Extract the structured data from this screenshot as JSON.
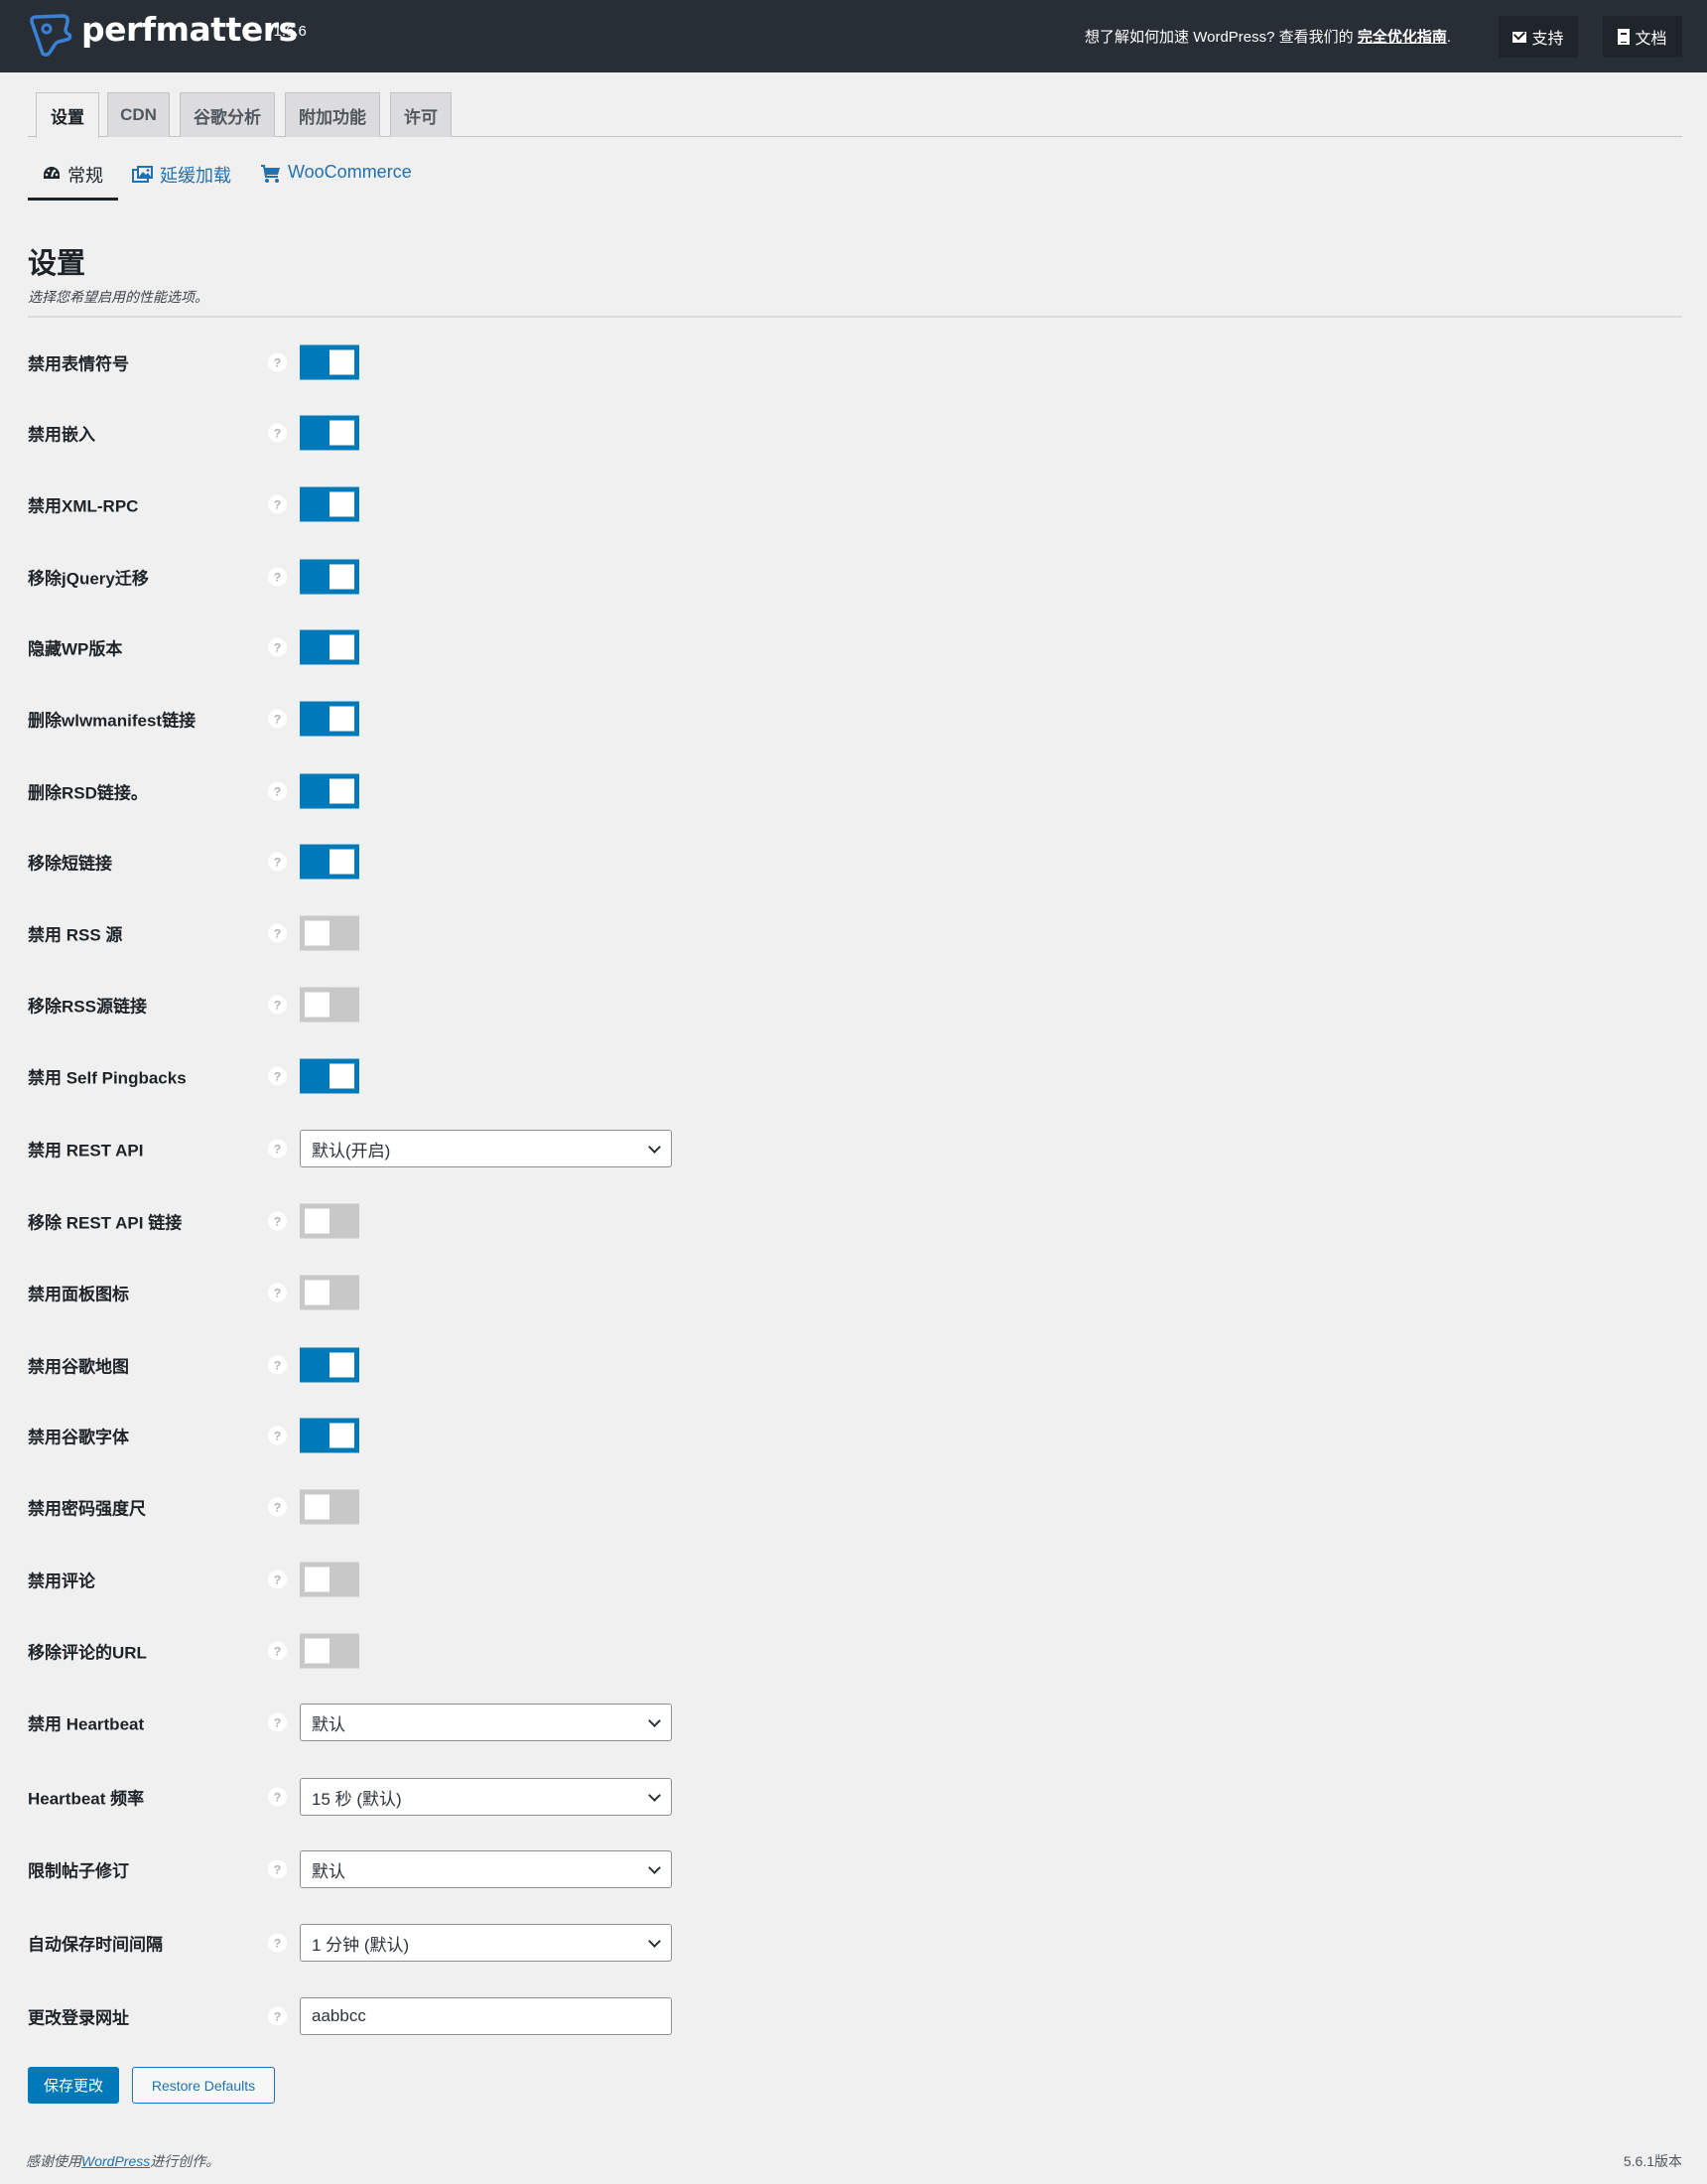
{
  "header": {
    "brand": "perfmatters",
    "version": "v1.6.6",
    "promo_text": "想了解如何加速 WordPress? 查看我们的 ",
    "promo_link": "完全优化指南",
    "promo_suffix": ".",
    "support_label": "支持",
    "docs_label": "文档",
    "support_icon": "envelope-icon",
    "docs_icon": "document-icon"
  },
  "tabs": [
    {
      "label": "设置",
      "active": true
    },
    {
      "label": "CDN",
      "active": false
    },
    {
      "label": "谷歌分析",
      "active": false
    },
    {
      "label": "附加功能",
      "active": false
    },
    {
      "label": "许可",
      "active": false
    }
  ],
  "subtabs": [
    {
      "label": "常规",
      "icon": "dashboard-icon",
      "active": true
    },
    {
      "label": "延缓加载",
      "icon": "images-icon",
      "active": false
    },
    {
      "label": "WooCommerce",
      "icon": "cart-icon",
      "active": false
    }
  ],
  "section": {
    "title": "设置",
    "description": "选择您希望启用的性能选项。"
  },
  "settings": [
    {
      "label": "禁用表情符号",
      "type": "toggle",
      "enabled": true
    },
    {
      "label": "禁用嵌入",
      "type": "toggle",
      "enabled": true
    },
    {
      "label": "禁用XML-RPC",
      "type": "toggle",
      "enabled": true
    },
    {
      "label": "移除jQuery迁移",
      "type": "toggle",
      "enabled": true
    },
    {
      "label": "隐藏WP版本",
      "type": "toggle",
      "enabled": true
    },
    {
      "label": "删除wlwmanifest链接",
      "type": "toggle",
      "enabled": true
    },
    {
      "label": "删除RSD链接。",
      "type": "toggle",
      "enabled": true
    },
    {
      "label": "移除短链接",
      "type": "toggle",
      "enabled": true
    },
    {
      "label": "禁用 RSS 源",
      "type": "toggle",
      "enabled": false
    },
    {
      "label": "移除RSS源链接",
      "type": "toggle",
      "enabled": false
    },
    {
      "label": "禁用 Self Pingbacks",
      "type": "toggle",
      "enabled": true
    },
    {
      "label": "禁用 REST API",
      "type": "select",
      "value": "默认(开启)"
    },
    {
      "label": "移除 REST API 链接",
      "type": "toggle",
      "enabled": false
    },
    {
      "label": "禁用面板图标",
      "type": "toggle",
      "enabled": false
    },
    {
      "label": "禁用谷歌地图",
      "type": "toggle",
      "enabled": true
    },
    {
      "label": "禁用谷歌字体",
      "type": "toggle",
      "enabled": true
    },
    {
      "label": "禁用密码强度尺",
      "type": "toggle",
      "enabled": false
    },
    {
      "label": "禁用评论",
      "type": "toggle",
      "enabled": false
    },
    {
      "label": "移除评论的URL",
      "type": "toggle",
      "enabled": false
    },
    {
      "label": "禁用 Heartbeat",
      "type": "select",
      "value": "默认"
    },
    {
      "label": "Heartbeat 频率",
      "type": "select",
      "value": "15 秒 (默认)"
    },
    {
      "label": "限制帖子修订",
      "type": "select",
      "value": "默认"
    },
    {
      "label": "自动保存时间间隔",
      "type": "select",
      "value": "1 分钟 (默认)"
    },
    {
      "label": "更改登录网址",
      "type": "text",
      "value": "aabbcc"
    }
  ],
  "help_glyph": "?",
  "actions": {
    "save_label": "保存更改",
    "restore_label": "Restore Defaults"
  },
  "footer": {
    "prefix": "感谢使用",
    "link": "WordPress",
    "suffix": "进行创作。",
    "version": "5.6.1版本"
  },
  "colors": {
    "accent": "#0079b8",
    "topbar": "#282e36",
    "toggle_off": "#c8c8c8"
  }
}
